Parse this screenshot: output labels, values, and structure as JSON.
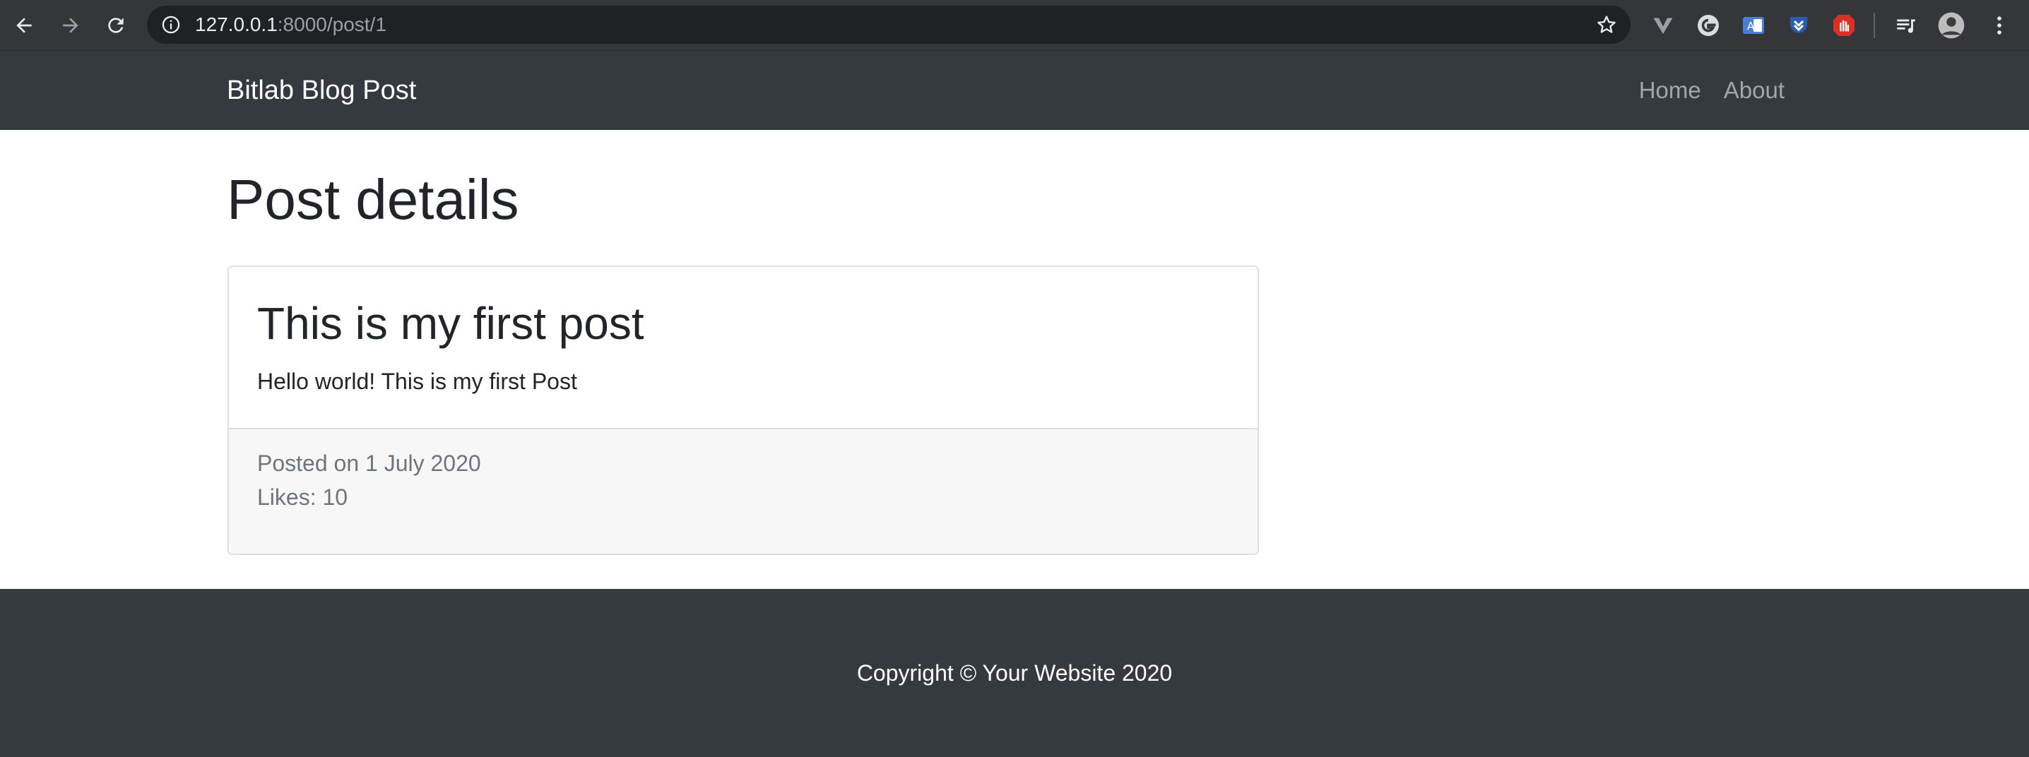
{
  "browser": {
    "url_host": "127.0.0.1",
    "url_rest": ":8000/post/1",
    "icons": [
      "back-arrow-icon",
      "forward-arrow-icon",
      "reload-icon",
      "info-icon",
      "star-icon",
      "vivaldi-v-icon",
      "g-extension-icon",
      "translate-extension-icon",
      "pocket-extension-icon",
      "adblock-extension-icon",
      "media-queue-icon",
      "profile-avatar",
      "kebab-menu-icon"
    ]
  },
  "navbar": {
    "brand": "Bitlab Blog Post",
    "links": [
      {
        "label": "Home"
      },
      {
        "label": "About"
      }
    ]
  },
  "main": {
    "page_title": "Post details",
    "post": {
      "title": "This is my first post",
      "body": "Hello world! This is my first Post",
      "posted_on": "Posted on 1 July 2020",
      "likes": "Likes: 10"
    }
  },
  "footer": {
    "copyright": "Copyright © Your Website 2020"
  },
  "colors": {
    "chrome_bg": "#35363a",
    "omnibox_bg": "#202124",
    "navbar_bg": "#343a40",
    "footer_bg": "#343a40",
    "card_footer_bg": "#f7f7f7",
    "muted_text": "#6c757d",
    "heading_text": "#212529"
  }
}
